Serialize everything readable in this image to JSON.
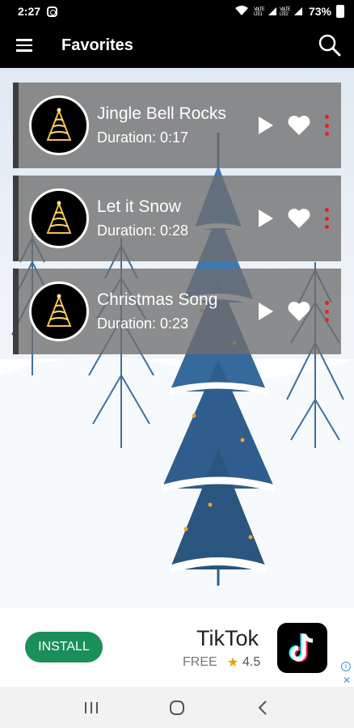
{
  "status_bar": {
    "time": "2:27",
    "signal_text": "VoLTE LTE1 VoLTE LTE2",
    "battery": "73%"
  },
  "app_bar": {
    "title": "Favorites"
  },
  "songs": [
    {
      "title": "Jingle Bell Rocks",
      "duration": "Duration: 0:17"
    },
    {
      "title": "Let it Snow",
      "duration": "Duration: 0:28"
    },
    {
      "title": "Christmas Song",
      "duration": "Duration: 0:23"
    }
  ],
  "ad": {
    "install_label": "INSTALL",
    "app_name": "TikTok",
    "price": "FREE",
    "rating": "4.5"
  },
  "colors": {
    "accent_red": "#e82020",
    "install_green": "#1a8f5a"
  },
  "icons": {
    "menu": "menu-icon",
    "search": "search-icon",
    "play": "play-icon",
    "favorite": "heart-icon",
    "more": "more-vertical-icon"
  }
}
